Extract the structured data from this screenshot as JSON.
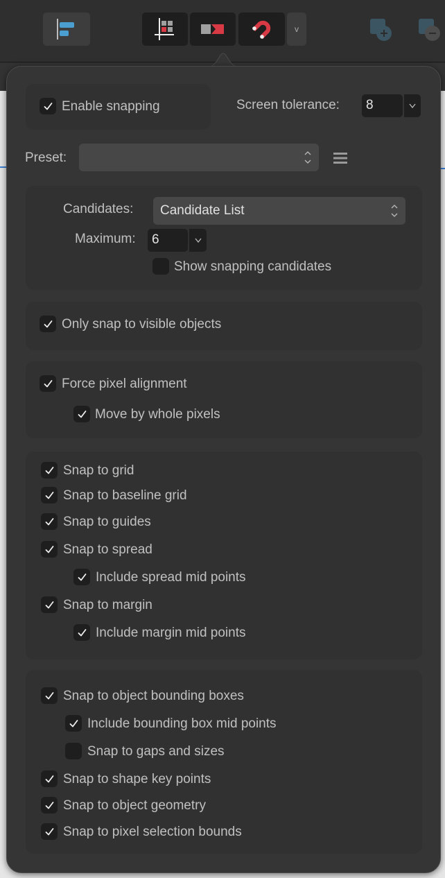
{
  "toolbar": {
    "buttons": [
      {
        "name": "alignment",
        "icon": "align-left-icon",
        "active": false
      },
      {
        "name": "grid-snapping",
        "icon": "grid-snap-icon",
        "active": true
      },
      {
        "name": "snap-object",
        "icon": "snap-object-icon",
        "active": true
      },
      {
        "name": "snapping",
        "icon": "magnet-icon",
        "active": true
      },
      {
        "name": "more",
        "icon": "chevron-down-icon",
        "label": "v"
      }
    ],
    "right_icons": [
      "add-shape-icon",
      "subtract-shape-icon"
    ]
  },
  "colors": {
    "accent_red": "#d83a45",
    "accent_blue": "#4b9ed0",
    "panel_bg": "#353535",
    "group_bg": "#313131",
    "checkbox_bg": "#1e1e1e"
  },
  "snapping": {
    "enable": {
      "label": "Enable snapping",
      "checked": true
    },
    "screen_tolerance": {
      "label": "Screen tolerance:",
      "value": "8"
    },
    "preset": {
      "label": "Preset:",
      "value": ""
    },
    "candidates": {
      "label": "Candidates:",
      "value": "Candidate List"
    },
    "maximum": {
      "label": "Maximum:",
      "value": "6"
    },
    "show_candidates": {
      "label": "Show snapping candidates",
      "checked": false
    },
    "visible_only": {
      "label": "Only snap to visible objects",
      "checked": true
    },
    "force_pixel": {
      "label": "Force pixel alignment",
      "checked": true
    },
    "whole_pixels": {
      "label": "Move by whole pixels",
      "checked": true
    },
    "grid_group": [
      {
        "label": "Snap to grid",
        "checked": true,
        "indent": 0
      },
      {
        "label": "Snap to baseline grid",
        "checked": true,
        "indent": 0
      },
      {
        "label": "Snap to guides",
        "checked": true,
        "indent": 0
      },
      {
        "label": "Snap to spread",
        "checked": true,
        "indent": 0
      },
      {
        "label": "Include spread mid points",
        "checked": true,
        "indent": 1
      },
      {
        "label": "Snap to margin",
        "checked": true,
        "indent": 0
      },
      {
        "label": "Include margin mid points",
        "checked": true,
        "indent": 1
      }
    ],
    "object_group": [
      {
        "label": "Snap to object bounding boxes",
        "checked": true,
        "indent": 0
      },
      {
        "label": "Include bounding box mid points",
        "checked": true,
        "indent": 1
      },
      {
        "label": "Snap to gaps and sizes",
        "checked": false,
        "indent": 1
      },
      {
        "label": "Snap to shape key points",
        "checked": true,
        "indent": 0
      },
      {
        "label": "Snap to object geometry",
        "checked": true,
        "indent": 0
      },
      {
        "label": "Snap to pixel selection bounds",
        "checked": true,
        "indent": 0
      }
    ]
  }
}
